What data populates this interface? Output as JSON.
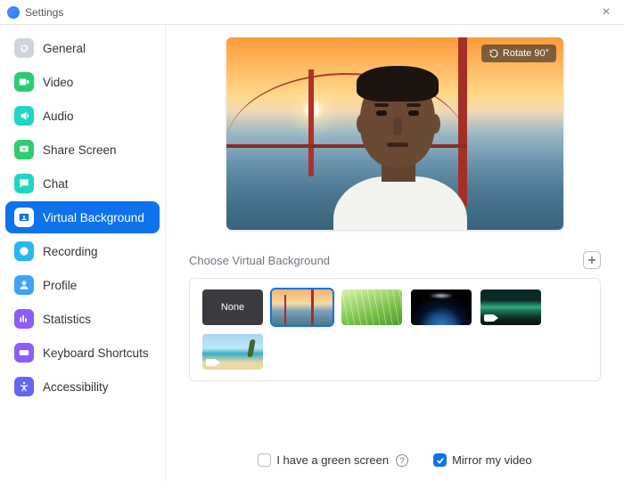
{
  "window": {
    "title": "Settings"
  },
  "sidebar": {
    "items": [
      {
        "label": "General",
        "icon": "gear",
        "color": "#d0d3d9",
        "active": false
      },
      {
        "label": "Video",
        "icon": "video",
        "color": "#2ecc71",
        "active": false
      },
      {
        "label": "Audio",
        "icon": "audio",
        "color": "#1fd6c4",
        "active": false
      },
      {
        "label": "Share Screen",
        "icon": "share",
        "color": "#2ecc71",
        "active": false
      },
      {
        "label": "Chat",
        "icon": "chat",
        "color": "#1fd6c4",
        "active": false
      },
      {
        "label": "Virtual Background",
        "icon": "vb",
        "color": "#0e72ed",
        "active": true
      },
      {
        "label": "Recording",
        "icon": "record",
        "color": "#29b6f6",
        "active": false
      },
      {
        "label": "Profile",
        "icon": "profile",
        "color": "#3fa2f7",
        "active": false
      },
      {
        "label": "Statistics",
        "icon": "stats",
        "color": "#8e5cf7",
        "active": false
      },
      {
        "label": "Keyboard Shortcuts",
        "icon": "keyboard",
        "color": "#8e5cf7",
        "active": false
      },
      {
        "label": "Accessibility",
        "icon": "accessibility",
        "color": "#6366f1",
        "active": false
      }
    ]
  },
  "preview": {
    "rotate_label": "Rotate 90°"
  },
  "section": {
    "title": "Choose Virtual Background"
  },
  "thumbnails": [
    {
      "kind": "none",
      "label": "None",
      "selected": false,
      "video": false
    },
    {
      "kind": "bridge",
      "label": "",
      "selected": true,
      "video": false
    },
    {
      "kind": "grass",
      "label": "",
      "selected": false,
      "video": false
    },
    {
      "kind": "earth",
      "label": "",
      "selected": false,
      "video": false
    },
    {
      "kind": "aurora",
      "label": "",
      "selected": false,
      "video": true
    },
    {
      "kind": "beach",
      "label": "",
      "selected": false,
      "video": true
    }
  ],
  "footer": {
    "green_screen": {
      "label": "I have a green screen",
      "checked": false
    },
    "mirror": {
      "label": "Mirror my video",
      "checked": true
    }
  }
}
